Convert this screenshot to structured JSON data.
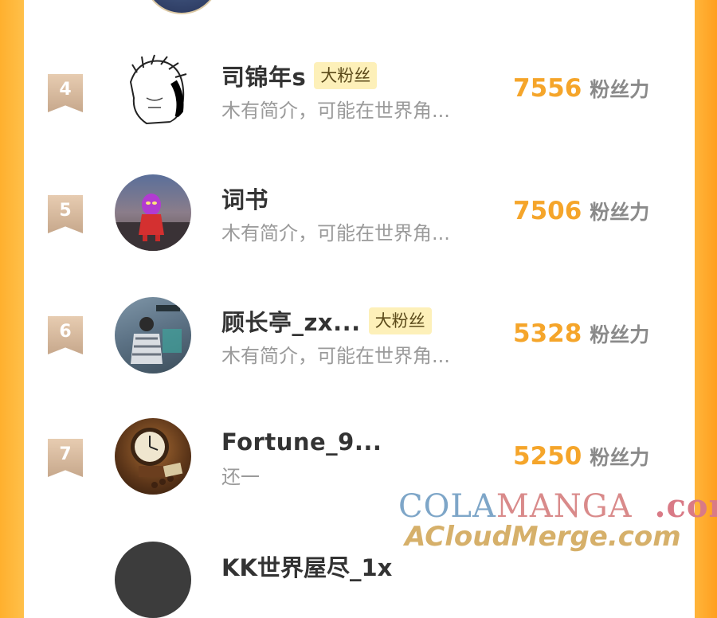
{
  "colors": {
    "accent_orange": "#f5a52a",
    "badge_bg": "#fdf0b9",
    "rank_bg": "#d2b596",
    "side_bar": "#ffb02e"
  },
  "unit_label": "粉丝力",
  "rows": [
    {
      "rank": "4",
      "name": "司锦年s",
      "badge": "大粉丝",
      "bio": "木有简介，可能在世界角...",
      "score": "7556",
      "avatar": "sketch-avatar"
    },
    {
      "rank": "5",
      "name": "词书",
      "badge": "",
      "bio": "木有简介，可能在世界角...",
      "score": "7506",
      "avatar": "ultraman-avatar"
    },
    {
      "rank": "6",
      "name": "顾长亭_zx...",
      "badge": "大粉丝",
      "bio": "木有简介，可能在世界角...",
      "score": "5328",
      "avatar": "photo-avatar"
    },
    {
      "rank": "7",
      "name": "Fortune_9...",
      "badge": "",
      "bio": "还一",
      "score": "5250",
      "avatar": "clock-avatar"
    }
  ],
  "partial_next_name": "KK世界屋尽_1x",
  "watermark": {
    "line1_cola": "COLA",
    "line1_manga": "MANGA",
    "line1_com": ".com",
    "line2": "ACloudMerge.com"
  }
}
